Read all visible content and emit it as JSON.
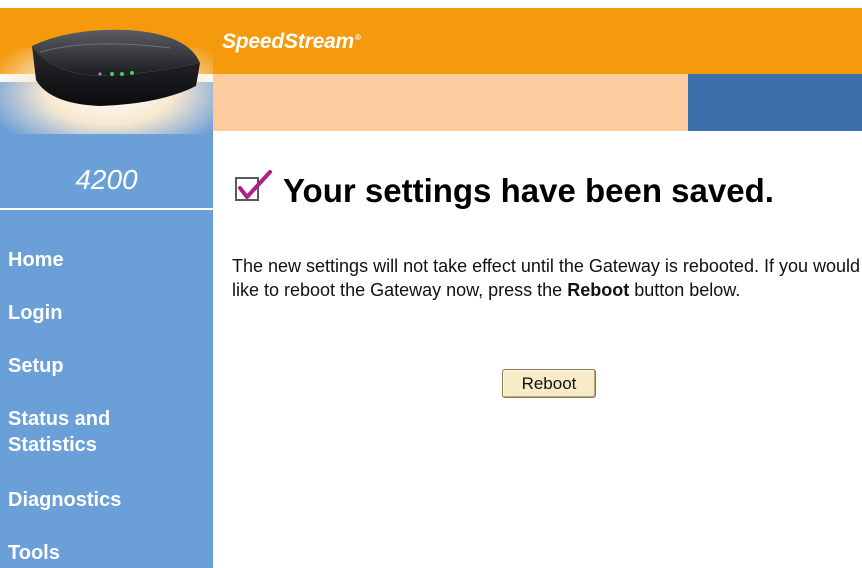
{
  "header": {
    "brand": "SpeedStream",
    "brand_mark": "®"
  },
  "sidebar": {
    "model": "4200",
    "items": [
      {
        "label": "Home"
      },
      {
        "label": "Login"
      },
      {
        "label": "Setup"
      },
      {
        "label": "Status and"
      },
      {
        "label": "Statistics"
      },
      {
        "label": "Diagnostics"
      },
      {
        "label": "Tools"
      }
    ]
  },
  "main": {
    "title": "Your settings have been saved.",
    "message_part1": "The new settings will not take effect until the Gateway is rebooted. If you would like to reboot the Gateway now, press the ",
    "message_bold": "Reboot",
    "message_part2": " button below.",
    "reboot_label": "Reboot"
  },
  "colors": {
    "orange": "#f49a0c",
    "peach": "#fccb9e",
    "sidebar_blue": "#6a9fd8",
    "dark_blue": "#3d6faa"
  },
  "icons": {
    "router": "router-image",
    "check": "checkbox-check-icon"
  }
}
